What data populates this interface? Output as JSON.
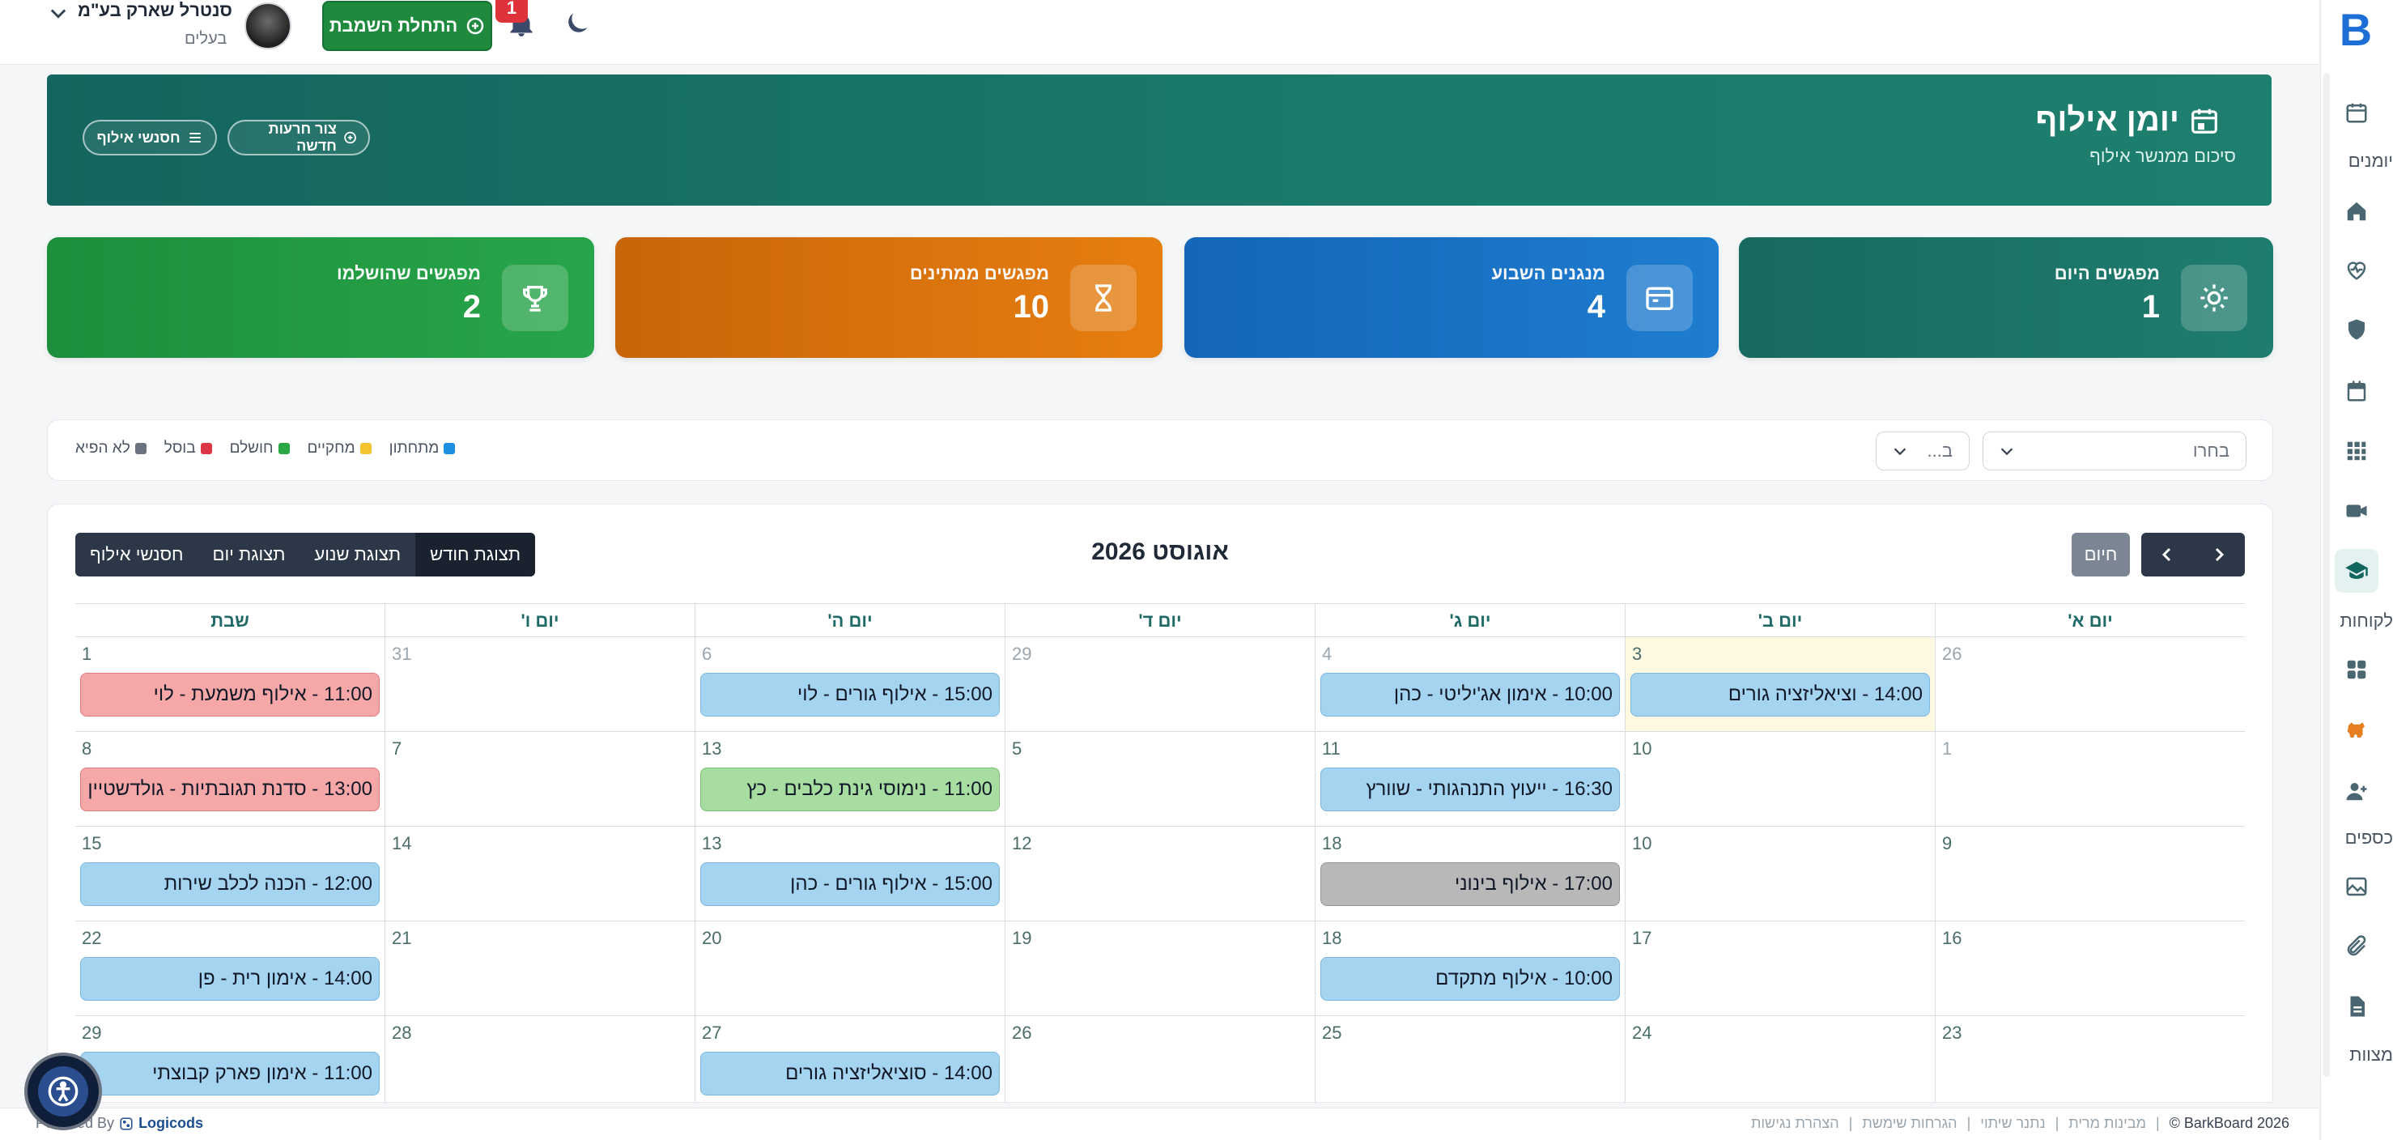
{
  "topbar": {
    "org_name": "סנטרל שארק בע\"מ",
    "org_sub": "בעלים",
    "add_button": "התחלת השמבת",
    "notifications_count": "1"
  },
  "sidebar": {
    "labels": [
      "יומנים",
      "לקוחות",
      "כספים",
      "מצוות"
    ]
  },
  "banner": {
    "title": "יומן אילוף",
    "subtitle": "סיכום ממנשר אילוף",
    "btn_new": "צור חרעות חדשה",
    "btn_sessions": "חסנשי אילוף"
  },
  "stats": [
    {
      "label": "מפגשים היום",
      "value": "1",
      "color": "#1c7266"
    },
    {
      "label": "מנגנים השבוע",
      "value": "4",
      "color": "#1771c4"
    },
    {
      "label": "מפגשים ממתינים",
      "value": "10",
      "color": "#d97409"
    },
    {
      "label": "מפגשים שהושלמו",
      "value": "2",
      "color": "#21943f"
    }
  ],
  "filters": {
    "select1_placeholder": "בחרו",
    "select2_placeholder": "ב...",
    "legend": [
      {
        "label": "מתחתון",
        "color": "#1d8ee0"
      },
      {
        "label": "מחקיים",
        "color": "#f4c430"
      },
      {
        "label": "חושלם",
        "color": "#2aa745"
      },
      {
        "label": "בוסל",
        "color": "#dc3545"
      },
      {
        "label": "לא הפיא",
        "color": "#6b7280"
      }
    ]
  },
  "calendar": {
    "title": "אוגוסט 2026",
    "today_label": "חיום",
    "view_tabs": [
      "תצוגת חודש",
      "תצוגת שנוע",
      "תצוגת יום",
      "חסנשי אילוף"
    ],
    "days_of_week": [
      "יום א'",
      "יום ב'",
      "יום ג'",
      "יום ד'",
      "יום ה'",
      "יום ו'",
      "שבת"
    ],
    "weeks": [
      [
        {
          "num": "26",
          "muted": true
        },
        {
          "num": "3",
          "today": true,
          "event": {
            "text": "14:00 - וציאליזציה גורים",
            "color": "blue"
          }
        },
        {
          "num": "4",
          "muted": true,
          "event": {
            "text": "10:00 - אימון אג'יליטי - כהן",
            "color": "blue"
          }
        },
        {
          "num": "29",
          "muted": true
        },
        {
          "num": "6",
          "muted": true,
          "event": {
            "text": "15:00 - אילוף גורים - לוי",
            "color": "blue"
          }
        },
        {
          "num": "31",
          "muted": true
        },
        {
          "num": "1",
          "event": {
            "text": "11:00 - אילוף משמעת - לוי",
            "color": "red"
          }
        }
      ],
      [
        {
          "num": "1",
          "muted": true
        },
        {
          "num": "10"
        },
        {
          "num": "11",
          "event": {
            "text": "16:30 - ייעוץ התנהגותי - שוורץ",
            "color": "blue"
          }
        },
        {
          "num": "5"
        },
        {
          "num": "13",
          "event": {
            "text": "11:00 - נימוסי גינת כלבים - כץ",
            "color": "green"
          }
        },
        {
          "num": "7"
        },
        {
          "num": "8",
          "event": {
            "text": "13:00 - סדנת תגובתיות - גולדשטיין",
            "color": "red"
          }
        }
      ],
      [
        {
          "num": "9"
        },
        {
          "num": "10"
        },
        {
          "num": "18",
          "event": {
            "text": "17:00 - אילוף בינוני",
            "color": "gray"
          }
        },
        {
          "num": "12"
        },
        {
          "num": "13",
          "event": {
            "text": "15:00 - אילוף גורים - כהן",
            "color": "blue"
          }
        },
        {
          "num": "14"
        },
        {
          "num": "15",
          "event": {
            "text": "12:00 - הכנה לכלב שירות",
            "color": "blue"
          }
        }
      ],
      [
        {
          "num": "16"
        },
        {
          "num": "17"
        },
        {
          "num": "18",
          "event": {
            "text": "10:00 - אילוף מתקדם",
            "color": "blue"
          }
        },
        {
          "num": "19"
        },
        {
          "num": "20"
        },
        {
          "num": "21"
        },
        {
          "num": "22",
          "event": {
            "text": "14:00 - אימון רית - פן",
            "color": "blue"
          }
        }
      ],
      [
        {
          "num": "23"
        },
        {
          "num": "24"
        },
        {
          "num": "25"
        },
        {
          "num": "26"
        },
        {
          "num": "27",
          "event": {
            "text": "14:00 - סוציאליזציה גורים",
            "color": "blue"
          }
        },
        {
          "num": "28"
        },
        {
          "num": "29",
          "event": {
            "text": "11:00 - אימון פארק קבוצתי",
            "color": "blue"
          }
        }
      ]
    ]
  },
  "footer": {
    "powered_by": "Powered By",
    "brand": "Logicods",
    "copyright": "BarkBoard 2026 ©",
    "links": [
      "מבינות מרית",
      "נתנר שיתוי",
      "הגרחות שימשת",
      "הצהרת נגישות"
    ]
  }
}
